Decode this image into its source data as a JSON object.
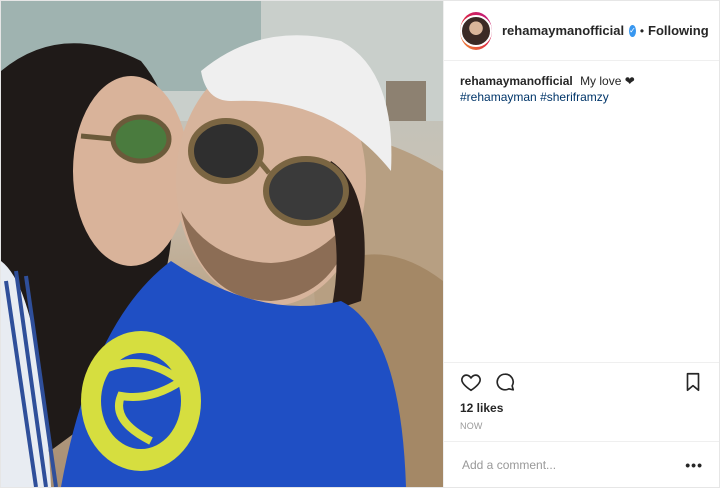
{
  "post": {
    "username": "rehamaymanofficial",
    "following_label": "Following",
    "caption": {
      "text": "My love ❤",
      "hashtags": [
        "#rehamayman",
        "#sheriframzy"
      ]
    },
    "likes": "12 likes",
    "timestamp": "NOW",
    "comment_placeholder": "Add a comment...",
    "more_label": "•••"
  },
  "colors": {
    "accent": "#3897f0",
    "hashtag": "#003569",
    "border": "#efefef",
    "muted": "#999999"
  },
  "icons": {
    "verified": "verified-badge-icon",
    "like": "heart-icon",
    "comment": "comment-bubble-icon",
    "save": "bookmark-icon",
    "options": "more-options-icon"
  }
}
